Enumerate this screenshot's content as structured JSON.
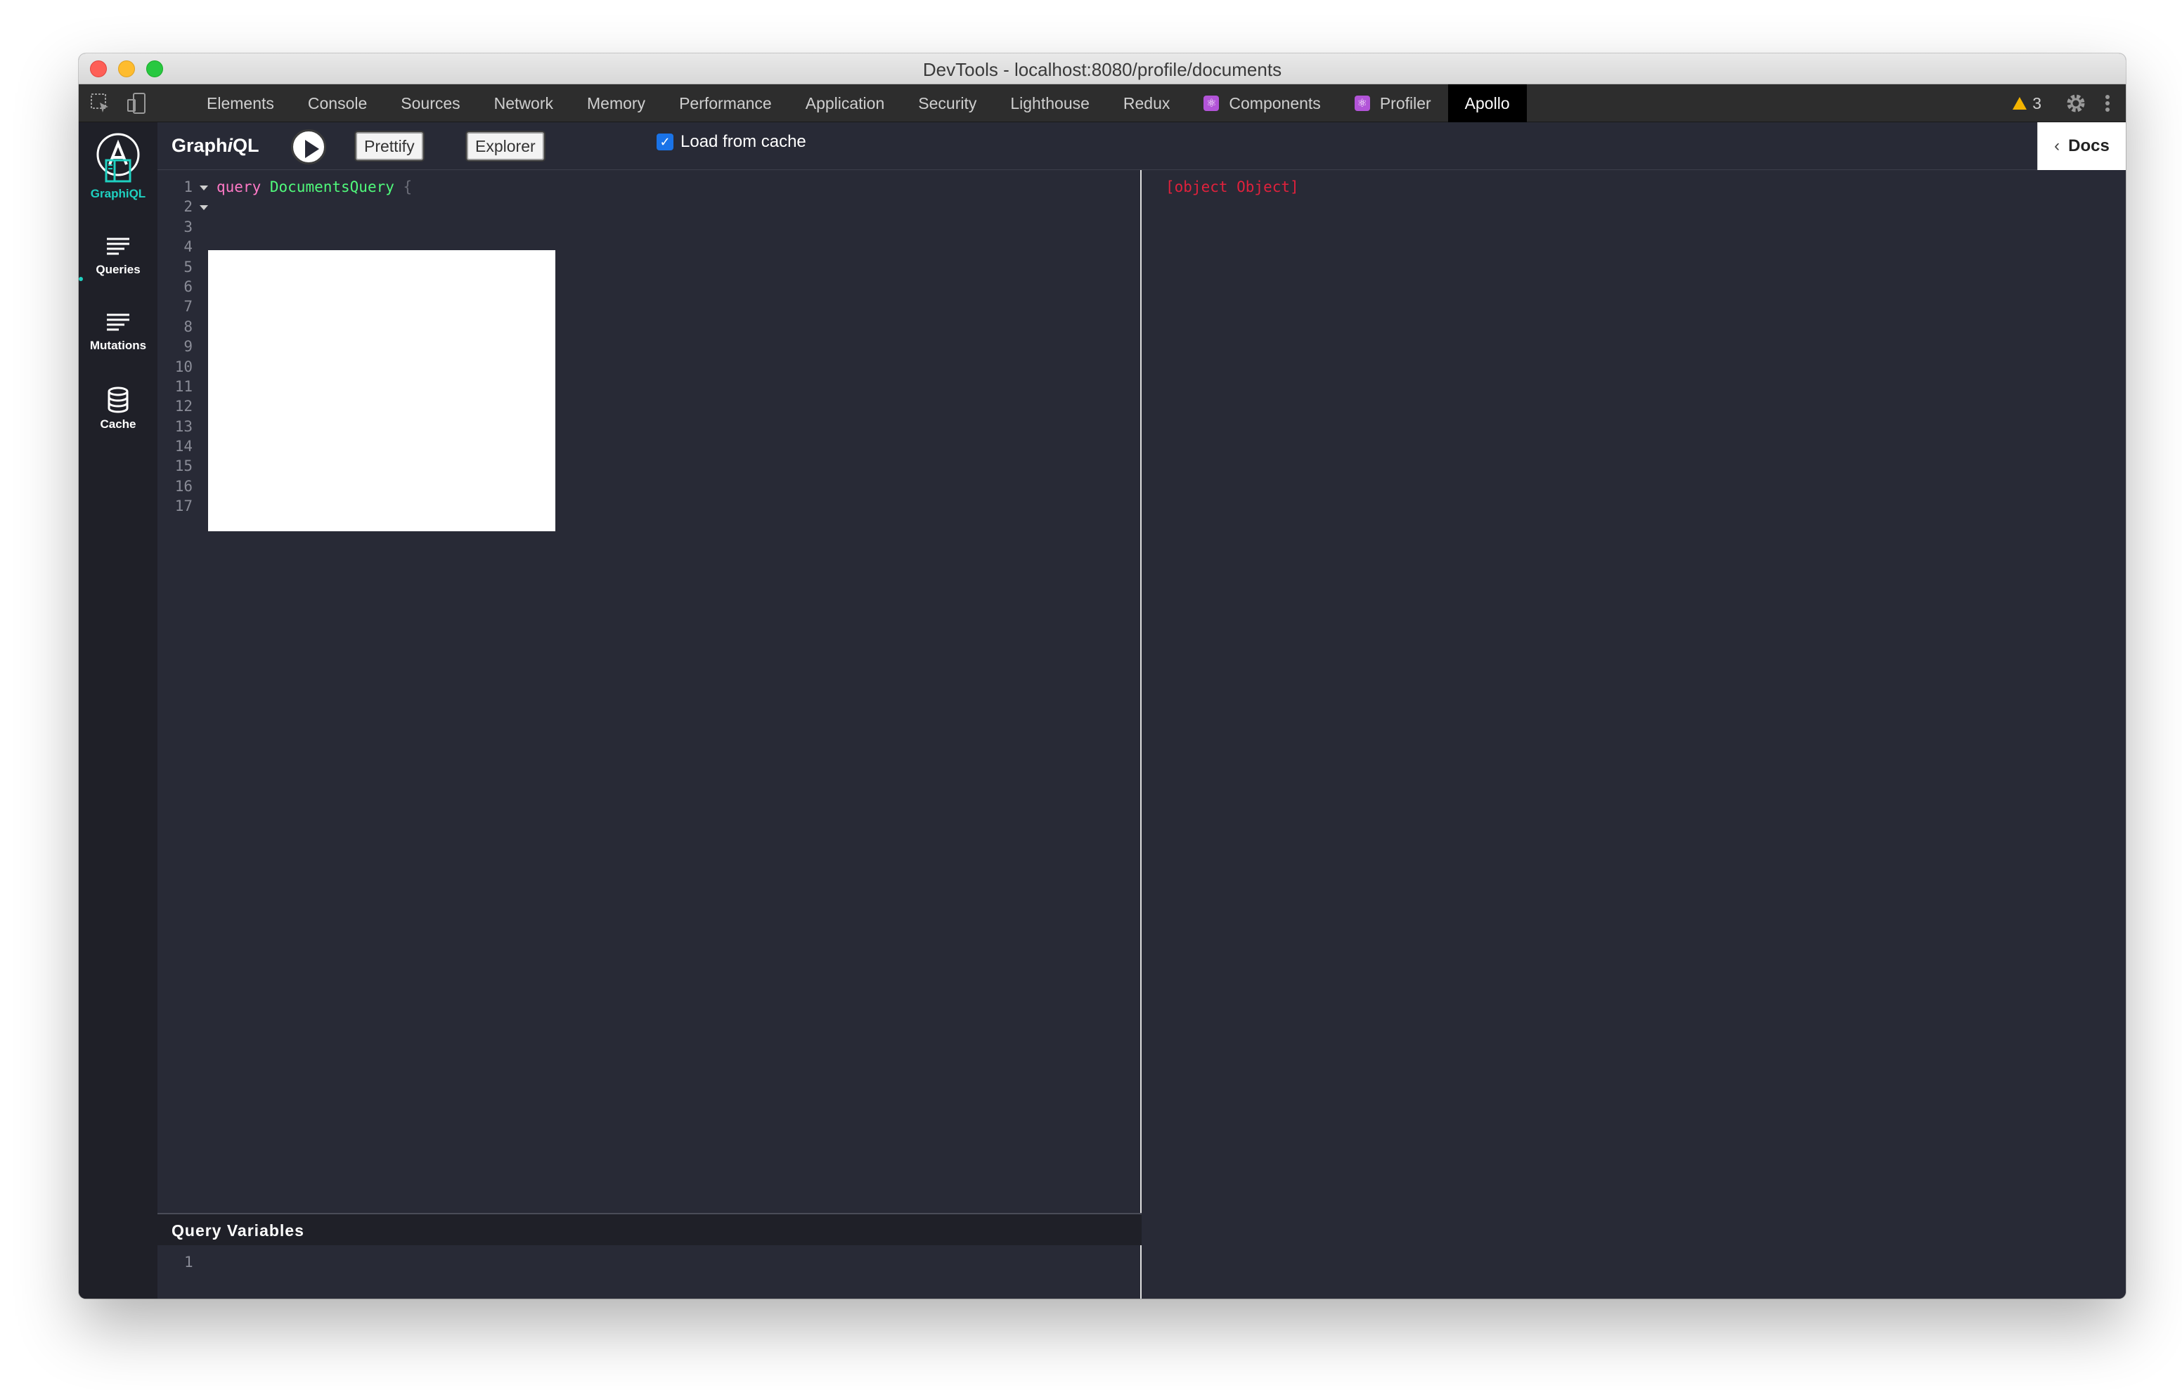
{
  "window": {
    "title": "DevTools - localhost:8080/profile/documents"
  },
  "devtools": {
    "tabs": [
      {
        "label": "Elements",
        "react": false,
        "active": false
      },
      {
        "label": "Console",
        "react": false,
        "active": false
      },
      {
        "label": "Sources",
        "react": false,
        "active": false
      },
      {
        "label": "Network",
        "react": false,
        "active": false
      },
      {
        "label": "Memory",
        "react": false,
        "active": false
      },
      {
        "label": "Performance",
        "react": false,
        "active": false
      },
      {
        "label": "Application",
        "react": false,
        "active": false
      },
      {
        "label": "Security",
        "react": false,
        "active": false
      },
      {
        "label": "Lighthouse",
        "react": false,
        "active": false
      },
      {
        "label": "Redux",
        "react": false,
        "active": false
      },
      {
        "label": "Components",
        "react": true,
        "active": false
      },
      {
        "label": "Profiler",
        "react": true,
        "active": false
      },
      {
        "label": "Apollo",
        "react": false,
        "active": true
      }
    ],
    "warnings_count": "3"
  },
  "sidebar": {
    "items": [
      {
        "label": "GraphiQL",
        "icon": "graphiql-icon",
        "active": true
      },
      {
        "label": "Queries",
        "icon": "queries-icon",
        "active": false
      },
      {
        "label": "Mutations",
        "icon": "mutations-icon",
        "active": false
      },
      {
        "label": "Cache",
        "icon": "cache-icon",
        "active": false
      }
    ]
  },
  "toolbar": {
    "title_main": "Graph",
    "title_italic": "i",
    "title_end": "QL",
    "prettify_label": "Prettify",
    "explorer_label": "Explorer",
    "load_from_cache_label": "Load from cache",
    "load_from_cache_checked": true,
    "docs_label": "Docs"
  },
  "editor": {
    "line_numbers": [
      "1",
      "2",
      "3",
      "4",
      "5",
      "6",
      "7",
      "8",
      "9",
      "10",
      "11",
      "12",
      "13",
      "14",
      "15",
      "16",
      "17"
    ],
    "keyword": "query",
    "query_name": "DocumentsQuery",
    "open_brace": "{",
    "close_brace": "}"
  },
  "query_variables": {
    "title": "Query Variables",
    "line_numbers": [
      "1"
    ]
  },
  "result": {
    "text": "[object Object]"
  },
  "colors": {
    "active_accent": "#1fd1c1",
    "keyword": "#ff79c6",
    "definition": "#50fa7b",
    "error": "#e0213c"
  }
}
